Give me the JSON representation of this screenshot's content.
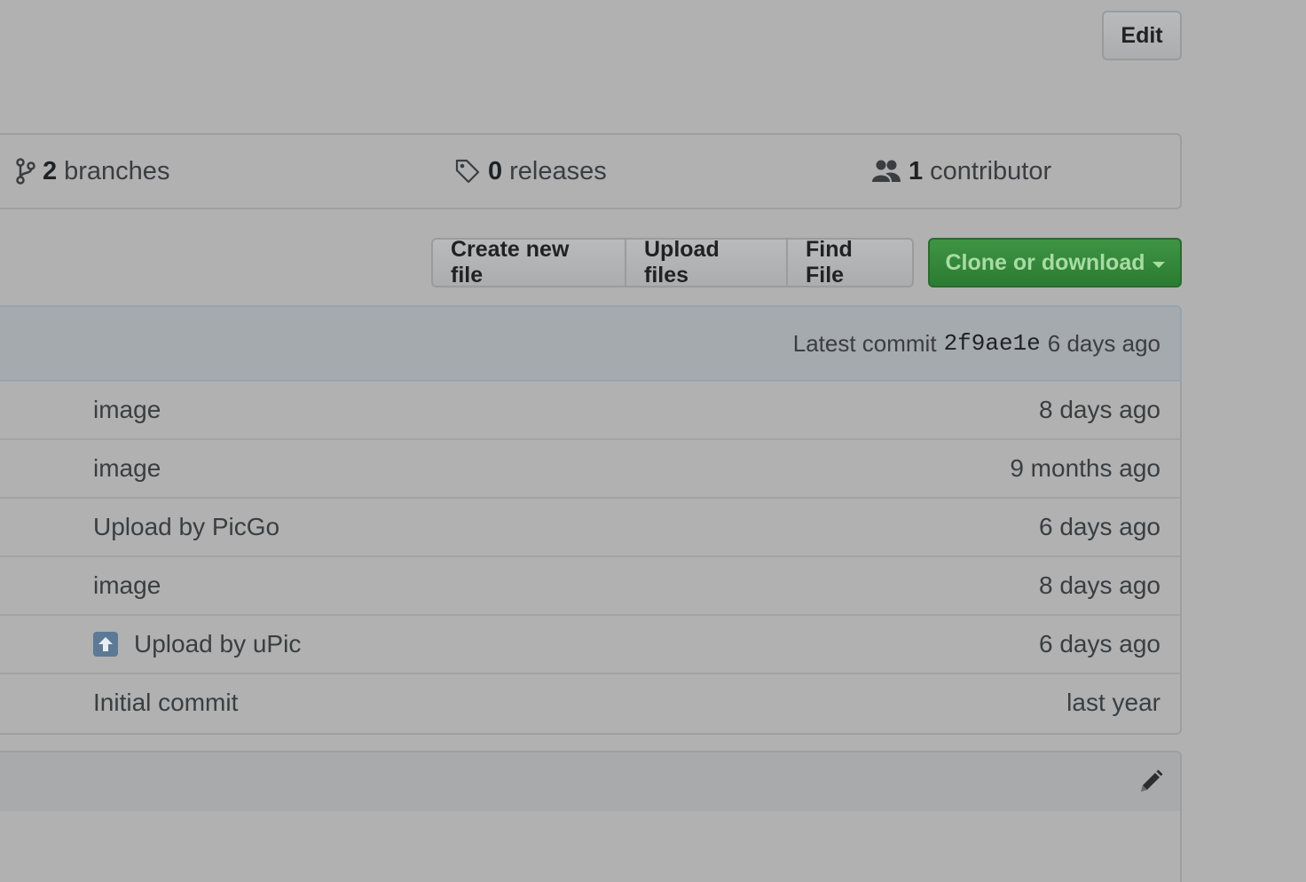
{
  "header": {
    "edit_label": "Edit"
  },
  "summary": {
    "branches_count": "2",
    "branches_label": "branches",
    "releases_count": "0",
    "releases_label": "releases",
    "contributors_count": "1",
    "contributors_label": "contributor"
  },
  "file_actions": {
    "create_label": "Create new file",
    "upload_label": "Upload files",
    "find_label": "Find File",
    "clone_label": "Clone or download"
  },
  "commit": {
    "prefix": "Latest commit",
    "sha": "2f9ae1e",
    "age": "6 days ago"
  },
  "files": [
    {
      "message": "image",
      "age": "8 days ago"
    },
    {
      "message": "image",
      "age": "9 months ago"
    },
    {
      "message": "Upload by PicGo",
      "age": "6 days ago"
    },
    {
      "message": "image",
      "age": "8 days ago"
    },
    {
      "message": "Upload by uPic",
      "age": "6 days ago",
      "icon": "up-arrow-icon"
    },
    {
      "message": "Initial commit",
      "age": "last year"
    }
  ],
  "colors": {
    "clone_button": "#2c7b32",
    "commit_bar": "#a5aaae",
    "overlay_bg": "#b1b1b1"
  }
}
